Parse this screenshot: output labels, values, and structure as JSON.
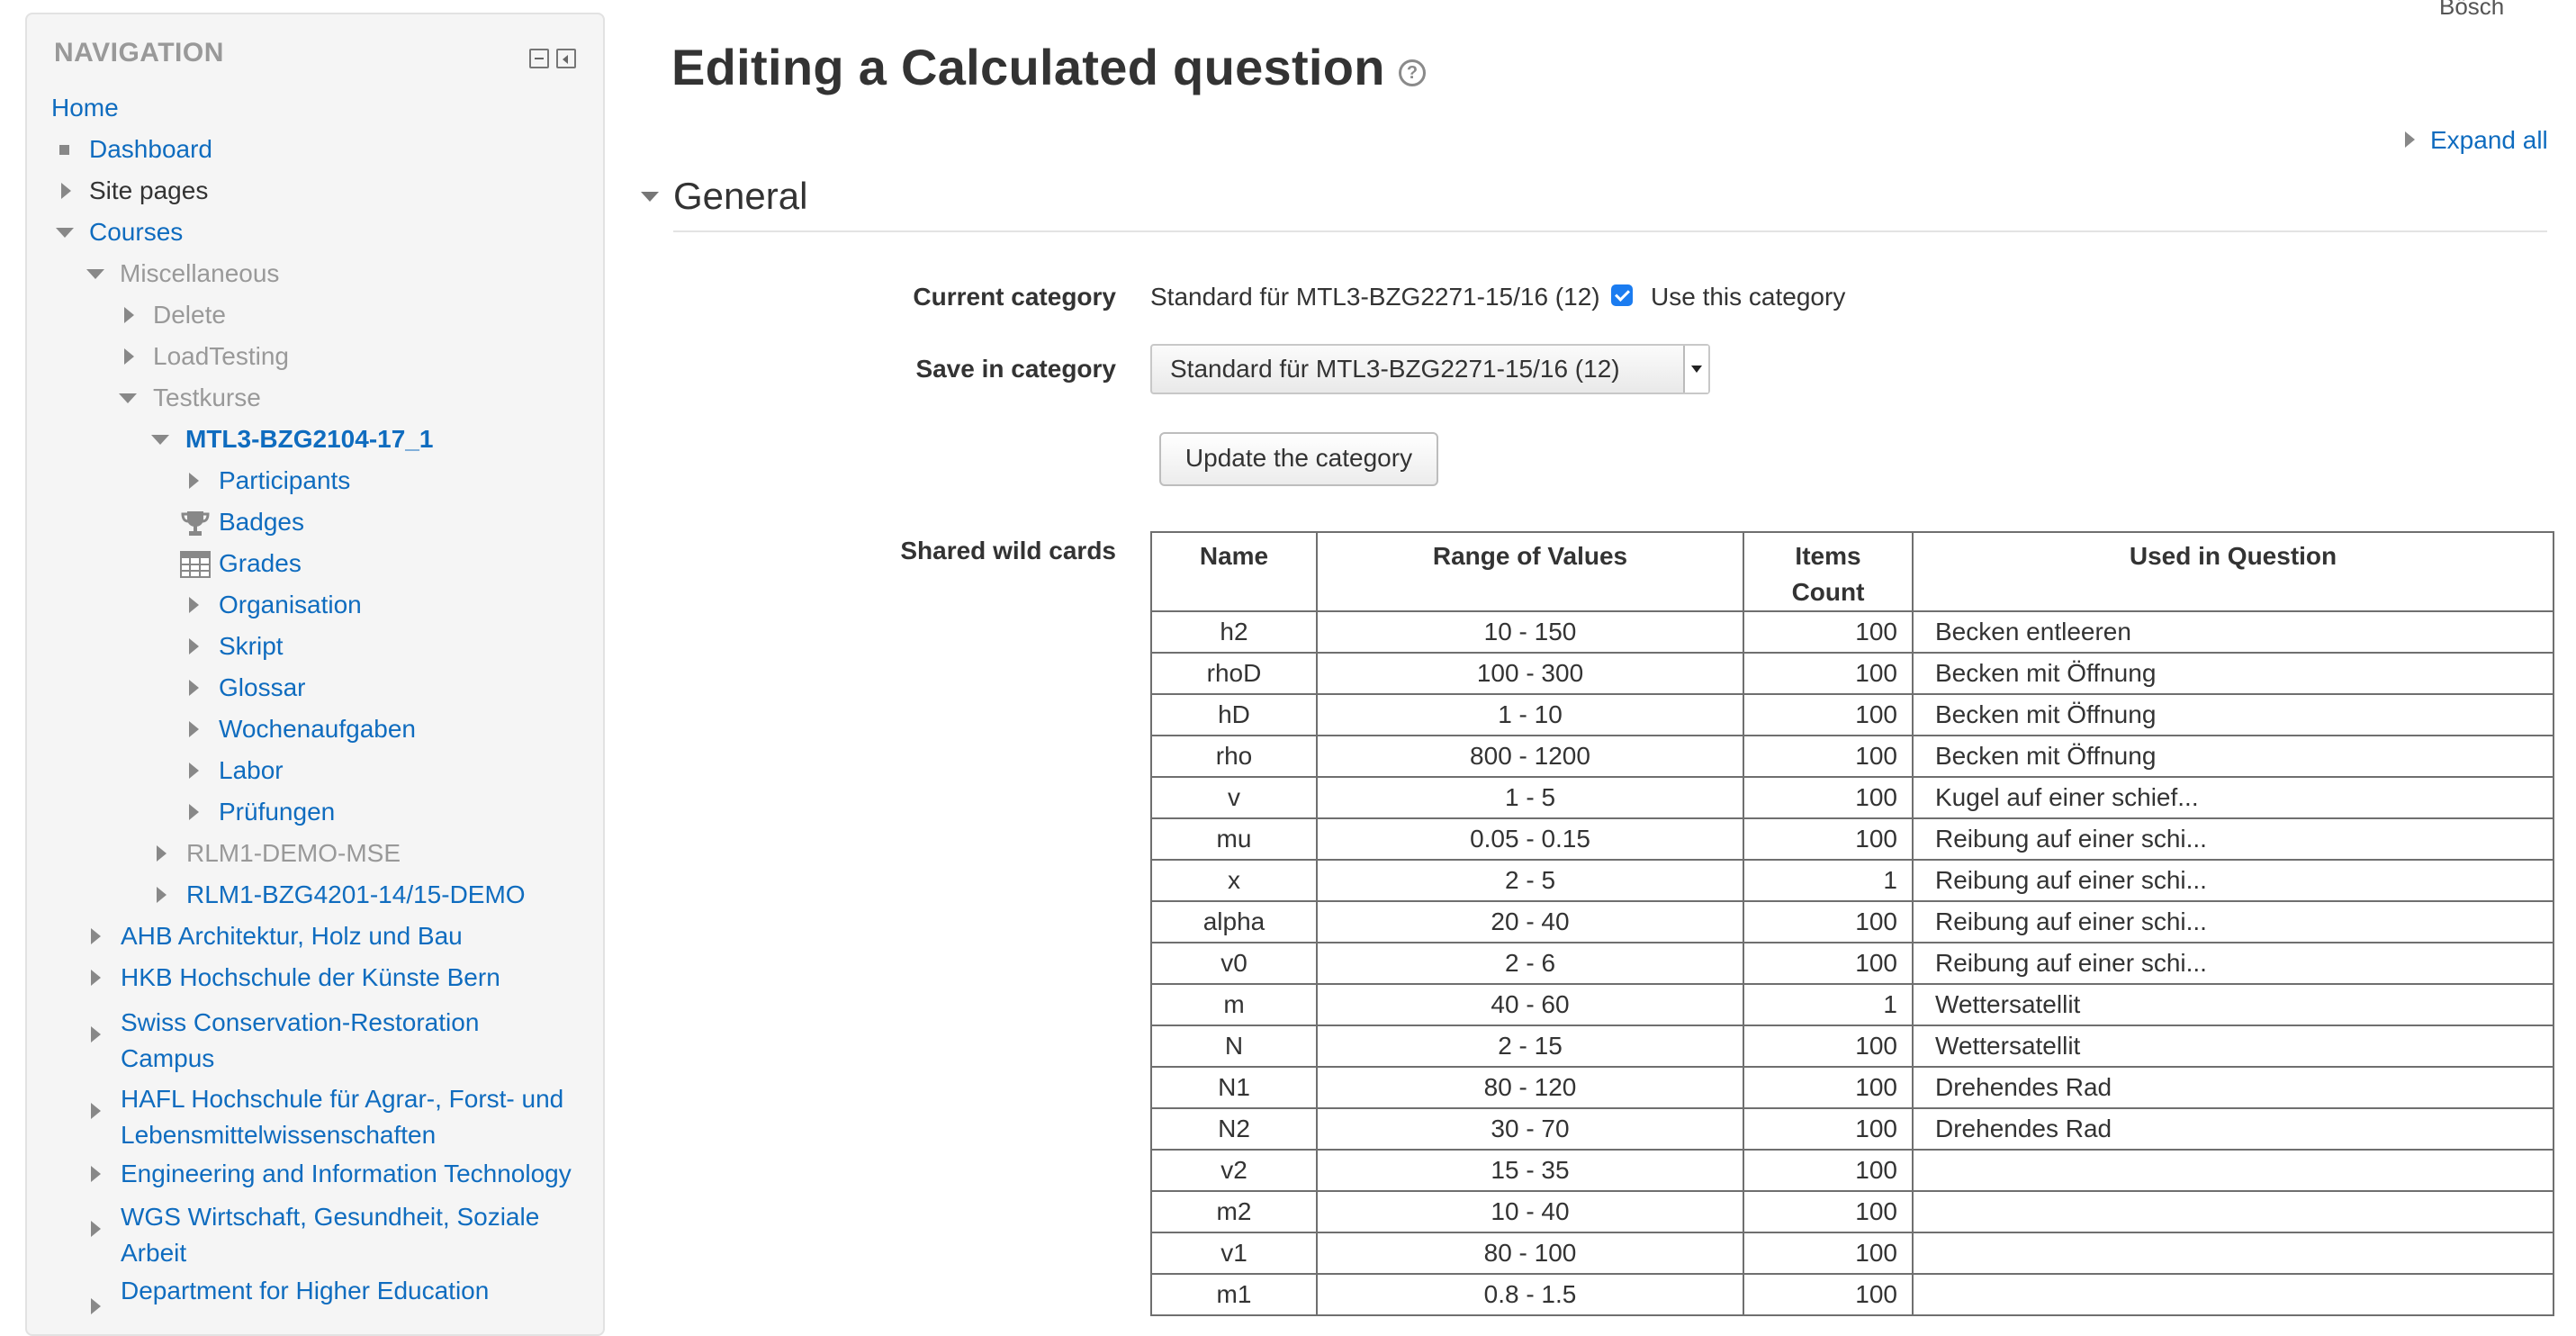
{
  "user": {
    "name": "Bösch"
  },
  "navigation": {
    "title": "NAVIGATION",
    "items": [
      {
        "label": "Home"
      },
      {
        "label": "Dashboard"
      },
      {
        "label": "Site pages"
      },
      {
        "label": "Courses"
      },
      {
        "label": "Miscellaneous"
      },
      {
        "label": "Delete"
      },
      {
        "label": "LoadTesting"
      },
      {
        "label": "Testkurse"
      },
      {
        "label": "MTL3-BZG2104-17_1"
      },
      {
        "label": "Participants"
      },
      {
        "label": "Badges"
      },
      {
        "label": "Grades"
      },
      {
        "label": "Organisation"
      },
      {
        "label": "Skript"
      },
      {
        "label": "Glossar"
      },
      {
        "label": "Wochenaufgaben"
      },
      {
        "label": "Labor"
      },
      {
        "label": "Prüfungen"
      },
      {
        "label": "RLM1-DEMO-MSE"
      },
      {
        "label": "RLM1-BZG4201-14/15-DEMO"
      },
      {
        "label": "AHB Architektur, Holz und Bau"
      },
      {
        "label": "HKB Hochschule der Künste Bern"
      },
      {
        "label": "Swiss Conservation-Restoration",
        "label2": "Campus"
      },
      {
        "label": "HAFL Hochschule für Agrar-, Forst- und",
        "label2": "Lebensmittelwissenschaften"
      },
      {
        "label": "Engineering and Information Technology"
      },
      {
        "label": "WGS Wirtschaft, Gesundheit, Soziale",
        "label2": "Arbeit"
      },
      {
        "label": "Department for Higher Education"
      }
    ]
  },
  "page": {
    "title": "Editing a Calculated question",
    "expand_all": "Expand all",
    "section": "General"
  },
  "form": {
    "current_category_label": "Current category",
    "current_category_value": "Standard für MTL3-BZG2271-15/16 (12)",
    "use_category_label": "Use this category",
    "save_in_category_label": "Save in category",
    "save_in_category_value": "Standard für MTL3-BZG2271-15/16 (12)",
    "update_button": "Update the category",
    "shared_wild_cards_label": "Shared wild cards"
  },
  "wildcards": {
    "headers": {
      "name": "Name",
      "range": "Range of Values",
      "count1": "Items",
      "count2": "Count",
      "used": "Used in Question"
    },
    "rows": [
      {
        "name": "h2",
        "range": "10 - 150",
        "count": "100",
        "used": "Becken entleeren"
      },
      {
        "name": "rhoD",
        "range": "100 - 300",
        "count": "100",
        "used": "Becken mit Öffnung"
      },
      {
        "name": "hD",
        "range": "1 - 10",
        "count": "100",
        "used": "Becken mit Öffnung"
      },
      {
        "name": "rho",
        "range": "800 - 1200",
        "count": "100",
        "used": "Becken mit Öffnung"
      },
      {
        "name": "v",
        "range": "1 - 5",
        "count": "100",
        "used": "Kugel auf einer schief..."
      },
      {
        "name": "mu",
        "range": "0.05 - 0.15",
        "count": "100",
        "used": "Reibung auf einer schi..."
      },
      {
        "name": "x",
        "range": "2 - 5",
        "count": "1",
        "used": "Reibung auf einer schi..."
      },
      {
        "name": "alpha",
        "range": "20 - 40",
        "count": "100",
        "used": "Reibung auf einer schi..."
      },
      {
        "name": "v0",
        "range": "2 - 6",
        "count": "100",
        "used": "Reibung auf einer schi..."
      },
      {
        "name": "m",
        "range": "40 - 60",
        "count": "1",
        "used": "Wettersatellit"
      },
      {
        "name": "N",
        "range": "2 - 15",
        "count": "100",
        "used": "Wettersatellit"
      },
      {
        "name": "N1",
        "range": "80 - 120",
        "count": "100",
        "used": "Drehendes Rad"
      },
      {
        "name": "N2",
        "range": "30 - 70",
        "count": "100",
        "used": "Drehendes Rad"
      },
      {
        "name": "v2",
        "range": "15 - 35",
        "count": "100",
        "used": ""
      },
      {
        "name": "m2",
        "range": "10 - 40",
        "count": "100",
        "used": ""
      },
      {
        "name": "v1",
        "range": "80 - 100",
        "count": "100",
        "used": ""
      },
      {
        "name": "m1",
        "range": "0.8 - 1.5",
        "count": "100",
        "used": ""
      }
    ]
  }
}
